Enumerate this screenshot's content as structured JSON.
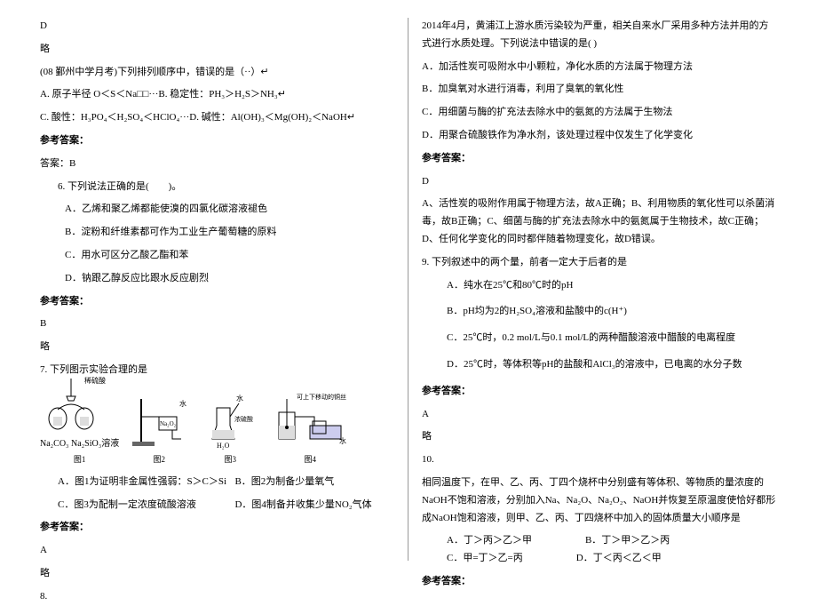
{
  "left": {
    "l1": "D",
    "l2": "略",
    "l3": "(08 鄞州中学月考)下列排列顺序中，错误的是（··）↵",
    "l4": "A. 原子半径 O＜S＜Na□□···B. 稳定性：PH₃＞H₂S＞NH₃↵",
    "l5": "C. 酸性：H₃PO₄＜H₂SO₄＜HClO₄···D. 碱性：Al(OH)₃＜Mg(OH)₂＜NaOH↵",
    "l6": "参考答案：",
    "l7": "答案：B",
    "l8": "6. 下列说法正确的是(　　)。",
    "l8a": "A．乙烯和聚乙烯都能使溴的四氯化碳溶液褪色",
    "l8b": "B．淀粉和纤维素都可作为工业生产葡萄糖的原料",
    "l8c": "C．用水可区分乙酸乙酯和苯",
    "l8d": "D．钠跟乙醇反应比跟水反应剧烈",
    "l9": "参考答案：",
    "l10": "B",
    "l11": "略",
    "l12": "7. 下列图示实验合理的是",
    "diag_label1_top": "稀硫酸",
    "diag_label1_bot": "Na₂CO₃ Na₂SiO₃溶液",
    "diag_caption1": "图1",
    "diag_label2": "Na₂O₂",
    "diag_caption2": "图2",
    "diag_label3a": "水",
    "diag_label3b": "浓硫酸",
    "diag_label3c": "H₂O",
    "diag_caption3": "图3",
    "diag_label4": "可上下移动的铜丝",
    "diag_label4b": "水",
    "diag_caption4": "图4",
    "l13a": "A．图1为证明非金属性强弱：S＞C＞Si",
    "l13b": "B．图2为制备少量氧气",
    "l13c": "C．图3为配制一定浓度硫酸溶液",
    "l13d": "D．图4制备并收集少量NO₂气体",
    "l14": "参考答案：",
    "l15": "A",
    "l16": "略",
    "l17": "8."
  },
  "right": {
    "r1": "2014年4月，黄浦江上游水质污染较为严重，相关自来水厂采用多种方法并用的方式进行水质处理。下列说法中错误的是(    )",
    "r1a": "A．加活性炭可吸附水中小颗粒，净化水质的方法属于物理方法",
    "r1b": "B．加臭氧对水进行消毒，利用了臭氧的氧化性",
    "r1c": "C．用细菌与酶的扩充法去除水中的氨氮的方法属于生物法",
    "r1d": "D．用聚合硫酸铁作为净水剂，该处理过程中仅发生了化学变化",
    "r2": "参考答案：",
    "r3": "D",
    "r4": "A、活性炭的吸附作用属于物理方法，故A正确；B、利用物质的氧化性可以杀菌消毒，故B正确；C、细菌与酶的扩充法去除水中的氨氮属于生物技术，故C正确；D、任何化学变化的同时都伴随着物理变化，故D错误。",
    "r5": "9. 下列叙述中的两个量，前者一定大于后者的是",
    "r5a": "A．纯水在25℃和80℃时的pH",
    "r5b": "B．pH均为2的H₂SO₄溶液和盐酸中的c(H⁺)",
    "r5c": "C．25℃时，0.2 mol/L与0.1 mol/L的两种醋酸溶液中醋酸的电离程度",
    "r5d": "D．25℃时，等体积等pH的盐酸和AlCl₃的溶液中，已电离的水分子数",
    "r6": "参考答案：",
    "r7": "A",
    "r8": "略",
    "r9": "10.",
    "r10": "相同温度下，在甲、乙、丙、丁四个烧杯中分别盛有等体积、等物质的量浓度的NaOH不饱和溶液，分别加入Na、Na₂O、Na₂O₂、NaOH并恢复至原温度使恰好都形成NaOH饱和溶液，则甲、乙、丙、丁四烧杯中加入的固体质量大小顺序是",
    "r10a": "A．丁＞丙＞乙＞甲",
    "r10b": "B．丁＞甲＞乙＞丙",
    "r10c": "C．甲=丁＞乙=丙",
    "r10d": "D．丁＜丙＜乙＜甲",
    "r11": "参考答案："
  }
}
